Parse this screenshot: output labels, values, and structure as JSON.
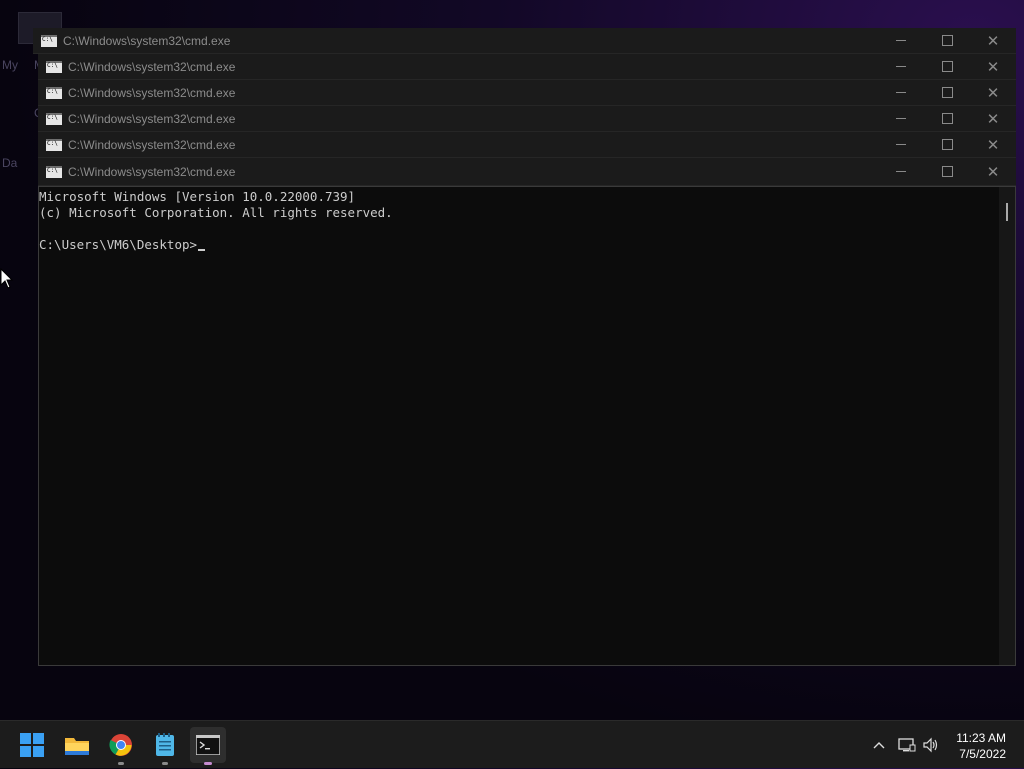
{
  "desktop": {
    "fragments": [
      "My",
      "M",
      "C",
      "Da"
    ]
  },
  "windows": [
    {
      "title": "C:\\Windows\\system32\\cmd.exe"
    },
    {
      "title": "C:\\Windows\\system32\\cmd.exe"
    },
    {
      "title": "C:\\Windows\\system32\\cmd.exe"
    },
    {
      "title": "C:\\Windows\\system32\\cmd.exe"
    },
    {
      "title": "C:\\Windows\\system32\\cmd.exe"
    },
    {
      "title": "C:\\Windows\\system32\\cmd.exe"
    }
  ],
  "console": {
    "lines": [
      "Microsoft Windows [Version 10.0.22000.739]",
      "(c) Microsoft Corporation. All rights reserved.",
      "",
      "C:\\Users\\VM6\\Desktop>"
    ]
  },
  "taskbar": {
    "apps": [
      {
        "name": "start",
        "icon": "windows-logo-icon"
      },
      {
        "name": "file-explorer",
        "icon": "folder-icon"
      },
      {
        "name": "chrome",
        "icon": "chrome-icon"
      },
      {
        "name": "notepad",
        "icon": "notepad-icon"
      },
      {
        "name": "command-prompt",
        "icon": "terminal-icon",
        "active": true
      }
    ],
    "tray": {
      "icons": [
        "chevron-up-icon",
        "network-icon",
        "volume-icon"
      ]
    },
    "clock": {
      "time": "11:23 AM",
      "date": "7/5/2022"
    }
  },
  "colors": {
    "console_bg": "#0c0c0c",
    "console_text": "#cccccc",
    "titlebar_bg": "#1b1b1b",
    "taskbar_bg": "#1c1c1c",
    "active_indicator": "#c58bd0"
  }
}
